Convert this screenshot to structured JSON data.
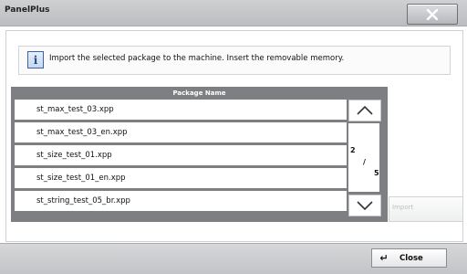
{
  "app": {
    "title": "PanelPlus",
    "close_glyph": "✕"
  },
  "message": {
    "icon": "info-icon",
    "icon_glyph": "i",
    "text": "Import the selected package to the machine. Insert the removable memory."
  },
  "package_list": {
    "header": "Package Name",
    "items": [
      "st_max_test_03.xpp",
      "st_max_test_03_en.xpp",
      "st_size_test_01.xpp",
      "st_size_test_01_en.xpp",
      "st_string_test_05_br.xpp"
    ]
  },
  "pager": {
    "current": "2",
    "separator": "/",
    "total": "5"
  },
  "buttons": {
    "import": "Import",
    "close": "Close",
    "enter_glyph": "↵"
  }
}
